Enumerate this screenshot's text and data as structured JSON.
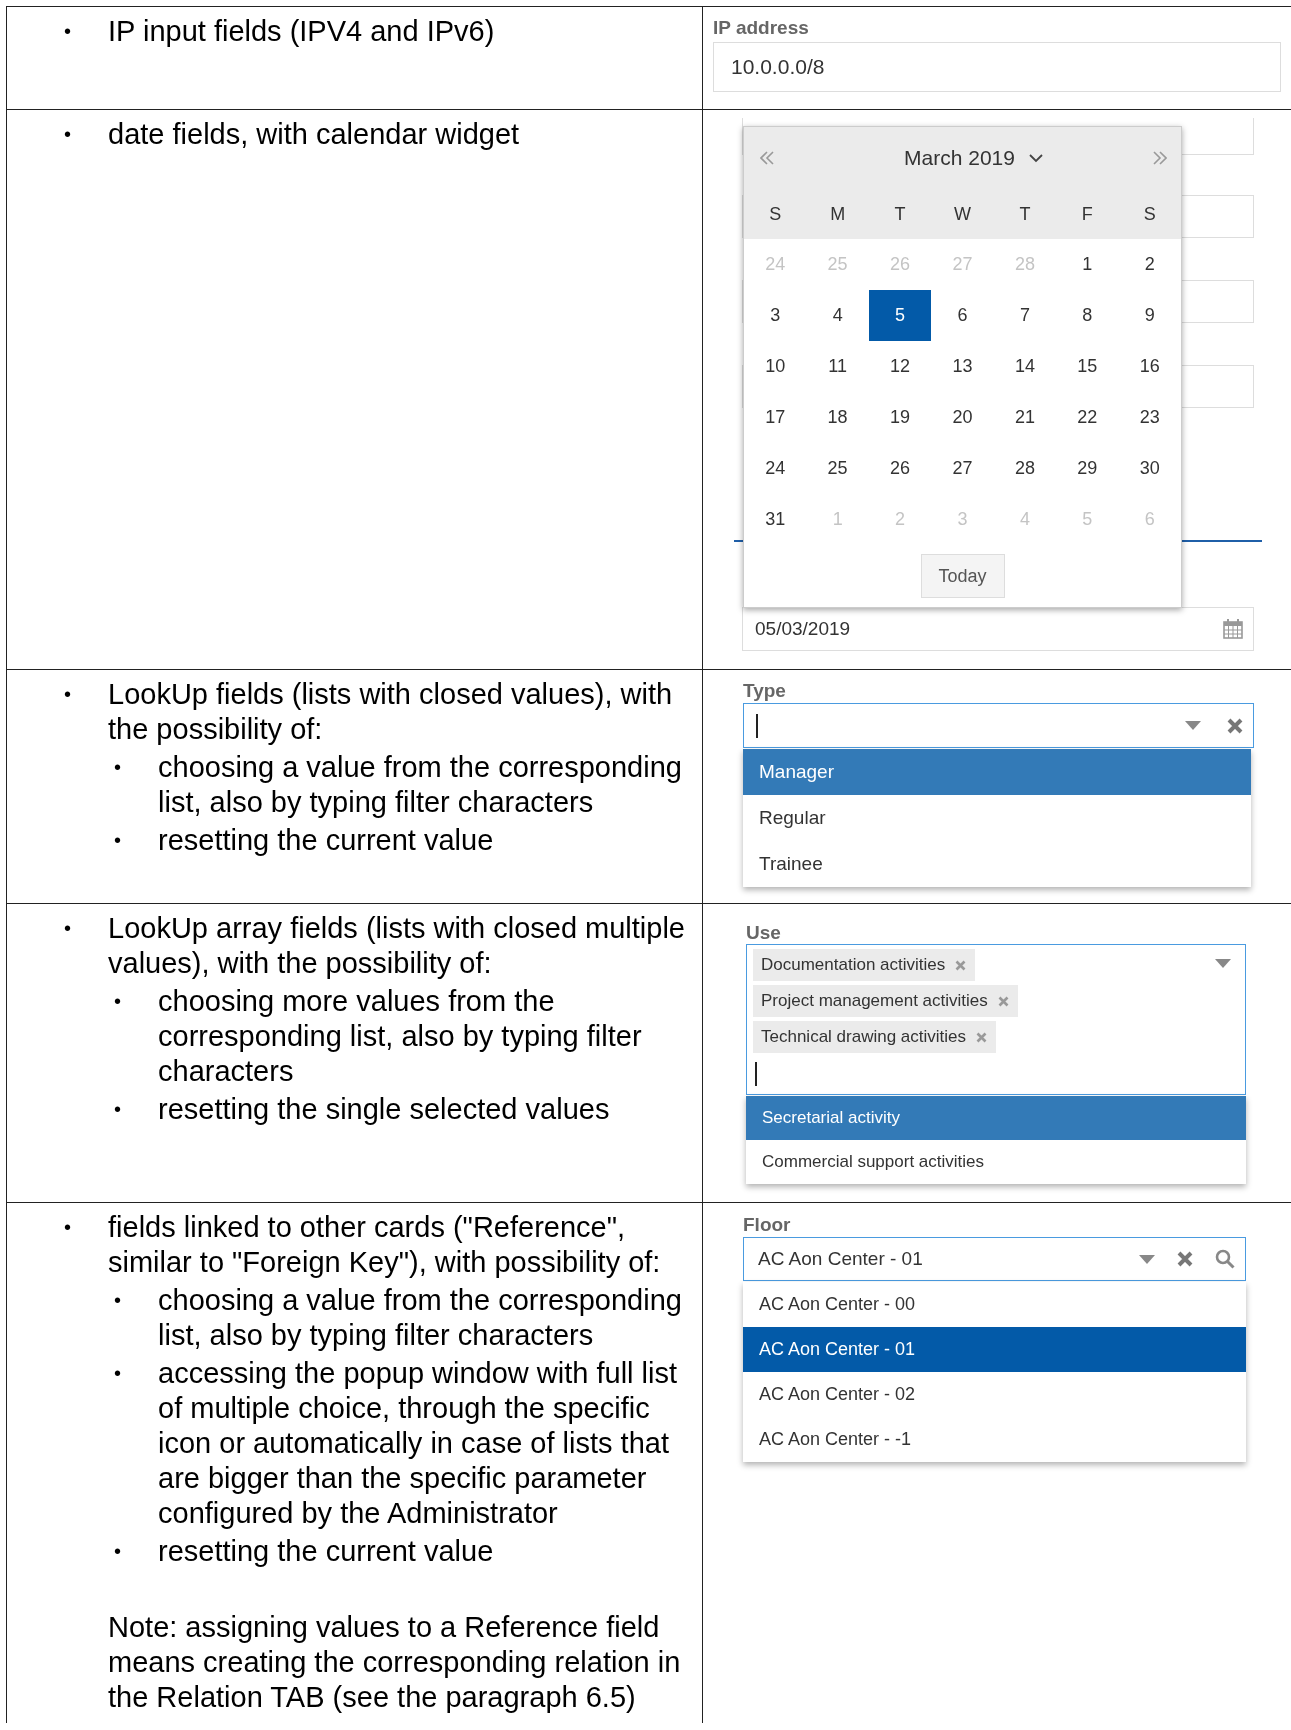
{
  "rows": [
    {
      "description": [
        {
          "bullet": "•",
          "text": "IP input fields (IPV4 and IPv6)"
        }
      ],
      "widget": {
        "kind": "ip",
        "label": "IP address",
        "value": "10.0.0.0/8"
      }
    },
    {
      "description": [
        {
          "bullet": "•",
          "text": "date fields, with calendar widget"
        }
      ],
      "widget": {
        "kind": "date",
        "value": "05/03/2019",
        "calendar": {
          "title": "March 2019",
          "today_button": "Today",
          "weekdays": [
            "S",
            "M",
            "T",
            "W",
            "T",
            "F",
            "S"
          ],
          "weeks": [
            [
              {
                "day": "24",
                "outside": true,
                "selected": false
              },
              {
                "day": "25",
                "outside": true,
                "selected": false
              },
              {
                "day": "26",
                "outside": true,
                "selected": false
              },
              {
                "day": "27",
                "outside": true,
                "selected": false
              },
              {
                "day": "28",
                "outside": true,
                "selected": false
              },
              {
                "day": "1",
                "outside": false,
                "selected": false
              },
              {
                "day": "2",
                "outside": false,
                "selected": false
              }
            ],
            [
              {
                "day": "3",
                "outside": false,
                "selected": false
              },
              {
                "day": "4",
                "outside": false,
                "selected": false
              },
              {
                "day": "5",
                "outside": false,
                "selected": true
              },
              {
                "day": "6",
                "outside": false,
                "selected": false
              },
              {
                "day": "7",
                "outside": false,
                "selected": false
              },
              {
                "day": "8",
                "outside": false,
                "selected": false
              },
              {
                "day": "9",
                "outside": false,
                "selected": false
              }
            ],
            [
              {
                "day": "10",
                "outside": false,
                "selected": false
              },
              {
                "day": "11",
                "outside": false,
                "selected": false
              },
              {
                "day": "12",
                "outside": false,
                "selected": false
              },
              {
                "day": "13",
                "outside": false,
                "selected": false
              },
              {
                "day": "14",
                "outside": false,
                "selected": false
              },
              {
                "day": "15",
                "outside": false,
                "selected": false
              },
              {
                "day": "16",
                "outside": false,
                "selected": false
              }
            ],
            [
              {
                "day": "17",
                "outside": false,
                "selected": false
              },
              {
                "day": "18",
                "outside": false,
                "selected": false
              },
              {
                "day": "19",
                "outside": false,
                "selected": false
              },
              {
                "day": "20",
                "outside": false,
                "selected": false
              },
              {
                "day": "21",
                "outside": false,
                "selected": false
              },
              {
                "day": "22",
                "outside": false,
                "selected": false
              },
              {
                "day": "23",
                "outside": false,
                "selected": false
              }
            ],
            [
              {
                "day": "24",
                "outside": false,
                "selected": false
              },
              {
                "day": "25",
                "outside": false,
                "selected": false
              },
              {
                "day": "26",
                "outside": false,
                "selected": false
              },
              {
                "day": "27",
                "outside": false,
                "selected": false
              },
              {
                "day": "28",
                "outside": false,
                "selected": false
              },
              {
                "day": "29",
                "outside": false,
                "selected": false
              },
              {
                "day": "30",
                "outside": false,
                "selected": false
              }
            ],
            [
              {
                "day": "31",
                "outside": false,
                "selected": false
              },
              {
                "day": "1",
                "outside": true,
                "selected": false
              },
              {
                "day": "2",
                "outside": true,
                "selected": false
              },
              {
                "day": "3",
                "outside": true,
                "selected": false
              },
              {
                "day": "4",
                "outside": true,
                "selected": false
              },
              {
                "day": "5",
                "outside": true,
                "selected": false
              },
              {
                "day": "6",
                "outside": true,
                "selected": false
              }
            ]
          ]
        }
      }
    },
    {
      "description": [
        {
          "bullet": "•",
          "text": "LookUp fields (lists with closed values), with the possibility of:",
          "children": [
            {
              "bullet": "•",
              "text": "choosing a value from the corresponding list, also by typing filter characters"
            },
            {
              "bullet": "•",
              "text": "resetting the current value"
            }
          ]
        }
      ],
      "widget": {
        "kind": "lookup",
        "label": "Type",
        "options": [
          {
            "label": "Manager",
            "selected": true
          },
          {
            "label": "Regular",
            "selected": false
          },
          {
            "label": "Trainee",
            "selected": false
          }
        ]
      }
    },
    {
      "description": [
        {
          "bullet": "•",
          "text": "LookUp array fields (lists with closed multiple values), with the possibility of:",
          "children": [
            {
              "bullet": "•",
              "text": "choosing more values from the corresponding list, also by typing filter characters"
            },
            {
              "bullet": "•",
              "text": "resetting the single selected values"
            }
          ]
        }
      ],
      "widget": {
        "kind": "lookup_array",
        "label": "Use",
        "tags": [
          "Documentation activities",
          "Project management activities",
          "Technical drawing activities"
        ],
        "options": [
          {
            "label": "Secretarial activity",
            "selected": true
          },
          {
            "label": "Commercial support activities",
            "selected": false
          }
        ]
      }
    },
    {
      "description": [
        {
          "bullet": "•",
          "text": "fields linked to other cards (\"Reference\", similar to \"Foreign Key\"), with possibility of:",
          "children": [
            {
              "bullet": "•",
              "text": "choosing a value from the corresponding list, also by typing filter characters"
            },
            {
              "bullet": "•",
              "text": "accessing the popup window with full list of multiple choice, through the specific icon or automatically in case of lists that are bigger than the specific parameter configured by the Administrator"
            },
            {
              "bullet": "•",
              "text": "resetting the current value"
            }
          ]
        }
      ],
      "note": "Note: assigning values to a Reference field means creating the corresponding relation in the Relation TAB (see the paragraph 6.5)",
      "widget": {
        "kind": "reference",
        "label": "Floor",
        "value": "AC Aon Center - 01",
        "options": [
          {
            "label": "AC Aon Center - 00",
            "selected": false
          },
          {
            "label": "AC Aon Center - 01",
            "selected": true
          },
          {
            "label": "AC Aon Center - 02",
            "selected": false
          },
          {
            "label": "AC Aon Center - -1",
            "selected": false
          }
        ]
      }
    }
  ]
}
